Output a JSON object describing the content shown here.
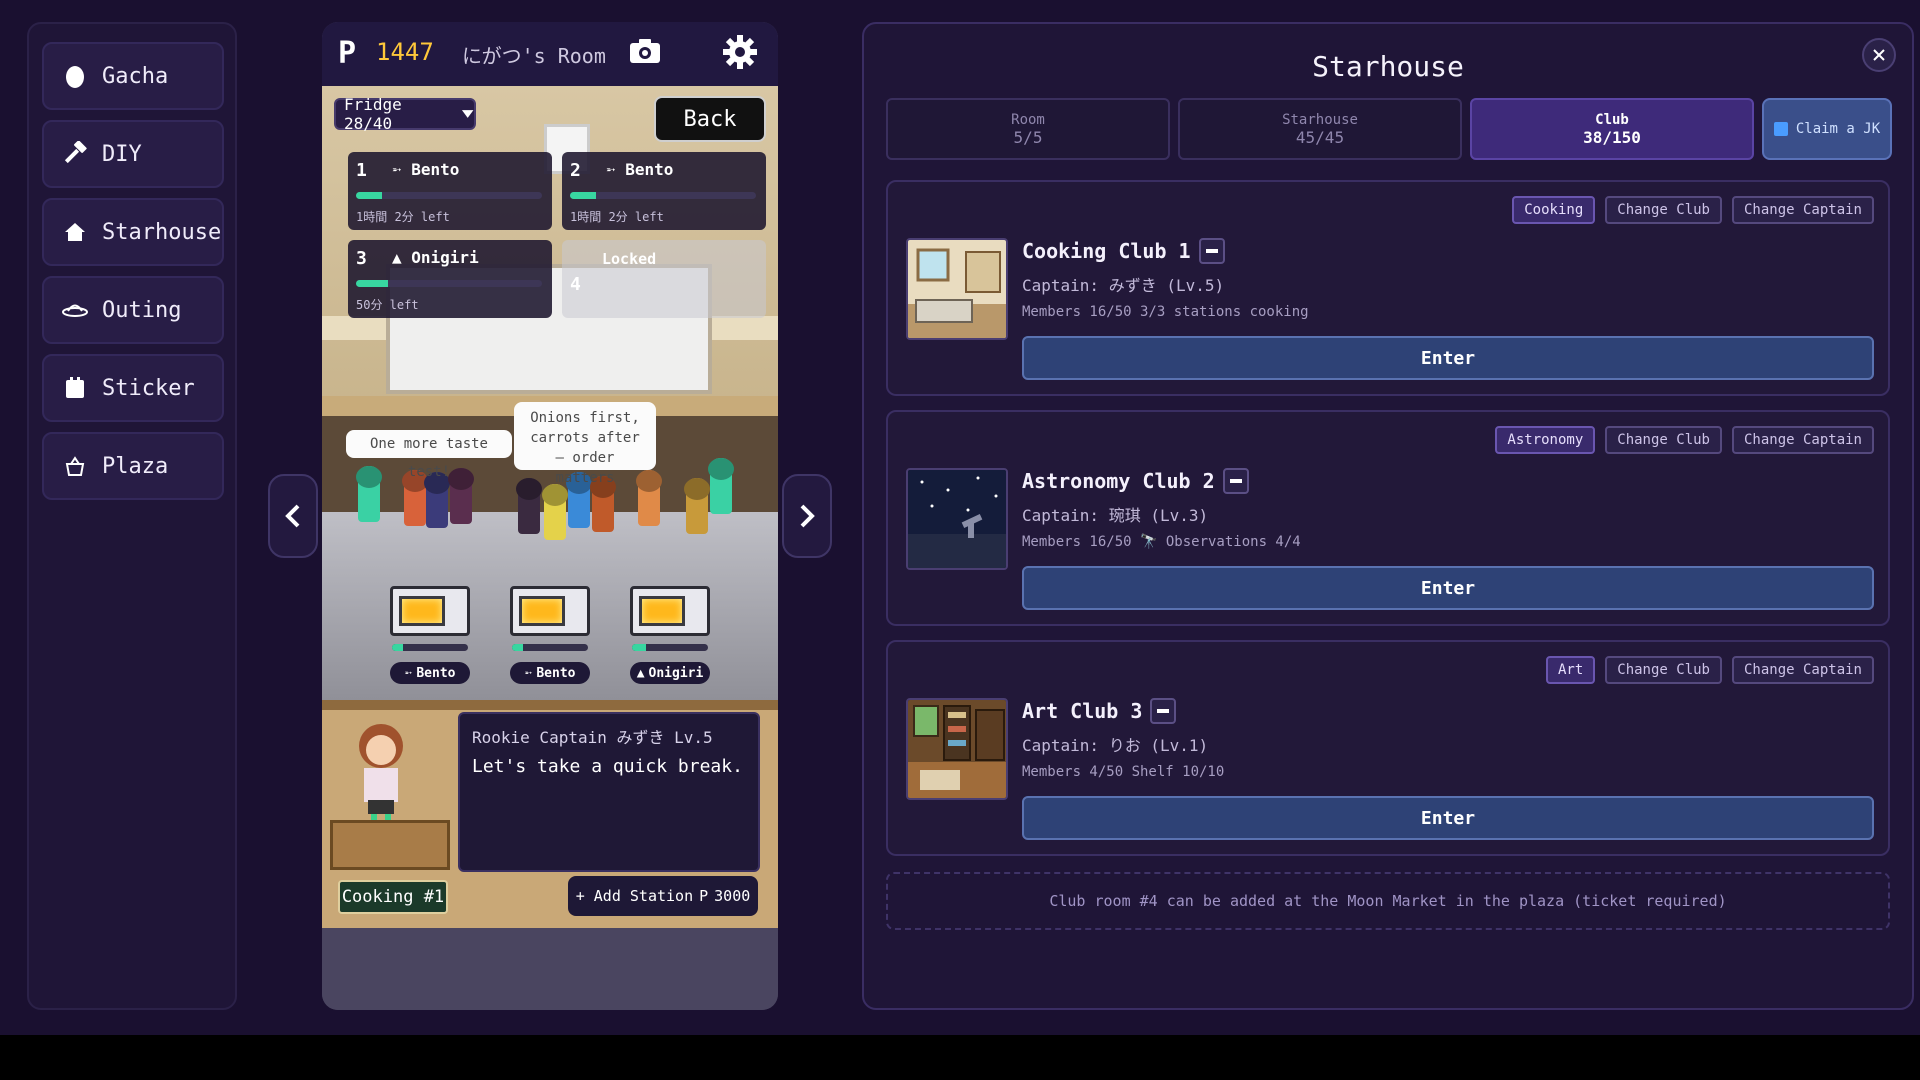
{
  "sidebar": {
    "items": [
      {
        "label": "Gacha",
        "icon": "egg-icon"
      },
      {
        "label": "DIY",
        "icon": "hammer-icon"
      },
      {
        "label": "Starhouse",
        "icon": "house-icon"
      },
      {
        "label": "Outing",
        "icon": "ufo-icon"
      },
      {
        "label": "Sticker",
        "icon": "sticker-icon"
      },
      {
        "label": "Plaza",
        "icon": "shop-icon"
      }
    ]
  },
  "game": {
    "coin_symbol": "P",
    "coins": "1447",
    "room_name": "にがつ's Room",
    "fridge_label": "Fridge 28/40",
    "back_label": "Back",
    "slots": [
      {
        "num": "1",
        "item": "Bento",
        "time_left": "1時間 2分 left",
        "progress": 0.14
      },
      {
        "num": "2",
        "item": "Bento",
        "time_left": "1時間 2分 left",
        "progress": 0.14
      },
      {
        "num": "3",
        "item": "Onigiri",
        "time_left": "50分 left",
        "progress": 0.17
      }
    ],
    "locked_slot": {
      "label": "Locked",
      "num": "4"
    },
    "bubbles": [
      {
        "text": "One more taste test!"
      },
      {
        "text": "Onions first, carrots after — order matters"
      }
    ],
    "stations": [
      {
        "item": "Bento",
        "progress": 0.15
      },
      {
        "item": "Bento",
        "progress": 0.15
      },
      {
        "item": "Onigiri",
        "progress": 0.18
      }
    ],
    "dialog": {
      "speaker": "Rookie Captain みずき Lv.5",
      "line": "Let's take a quick break."
    },
    "station_label": "Cooking #1",
    "add_station": {
      "label": "+ Add Station",
      "cost_symbol": "P",
      "cost": "3000"
    }
  },
  "panel": {
    "title": "Starhouse",
    "tabs": [
      {
        "label": "Room",
        "value": "5/5",
        "active": false
      },
      {
        "label": "Starhouse",
        "value": "45/45",
        "active": false
      },
      {
        "label": "Club",
        "value": "38/150",
        "active": true
      }
    ],
    "claim_label": "Claim a JK",
    "clubs": [
      {
        "name": "Cooking Club 1",
        "captain": "Captain: みずき (Lv.5)",
        "stats": "Members 16/50  3/3 stations cooking",
        "category": "Cooking",
        "change_club": "Change Club",
        "change_captain": "Change Captain",
        "enter": "Enter"
      },
      {
        "name": "Astronomy Club 2",
        "captain": "Captain: 琬琪 (Lv.3)",
        "stats": "Members 16/50  🔭 Observations 4/4",
        "category": "Astronomy",
        "change_club": "Change Club",
        "change_captain": "Change Captain",
        "enter": "Enter"
      },
      {
        "name": "Art Club 3",
        "captain": "Captain: りお (Lv.1)",
        "stats": "Members 4/50  Shelf 10/10",
        "category": "Art",
        "change_club": "Change Club",
        "change_captain": "Change Captain",
        "enter": "Enter"
      }
    ],
    "note": "Club room #4 can be added at the Moon Market in the plaza (ticket required)"
  },
  "colors": {
    "accent": "#3e2a7a",
    "coin": "#ffc83a",
    "progress": "#38d6a0",
    "enter_button": "#2e4276"
  }
}
